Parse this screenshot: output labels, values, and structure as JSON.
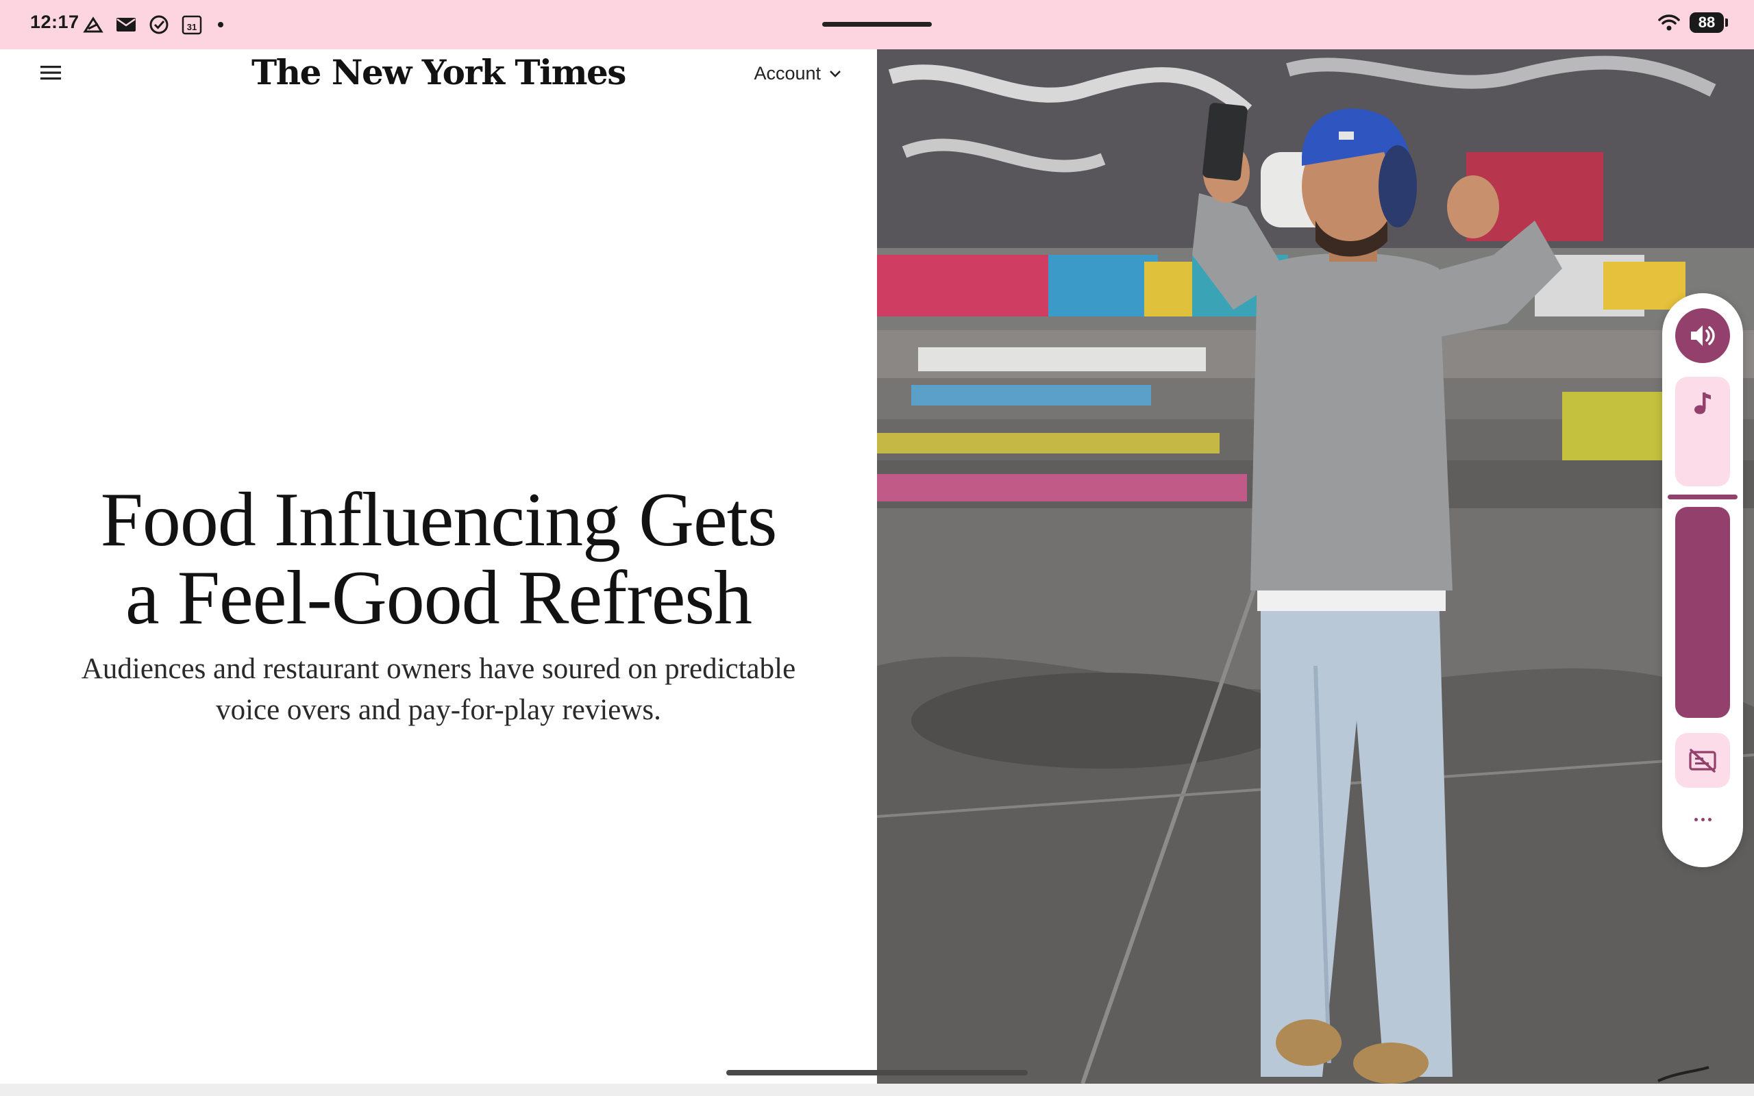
{
  "status_bar": {
    "time": "12:17",
    "icons": [
      "home-arrow-icon",
      "mail-icon",
      "check-circle-icon",
      "calendar-icon",
      "notification-dot"
    ],
    "calendar_day": "31",
    "battery": "88"
  },
  "header": {
    "logo": "The New York Times",
    "account_label": "Account"
  },
  "article": {
    "headline_line1": "Food Influencing Gets",
    "headline_line2": "a Feel-Good Refresh",
    "summary_line1": "Audiences and restaurant owners have soured on predictable",
    "summary_line2": "voice overs and pay-for-play reviews."
  },
  "volume_panel": {
    "accent_color": "#93406c",
    "tint_color": "#fcdce8",
    "icons": [
      "speaker-icon",
      "music-note-icon",
      "captions-off-icon",
      "more-icon"
    ]
  },
  "colors": {
    "status_bar": "#fcd5e0",
    "page_background": "#ffffff"
  }
}
